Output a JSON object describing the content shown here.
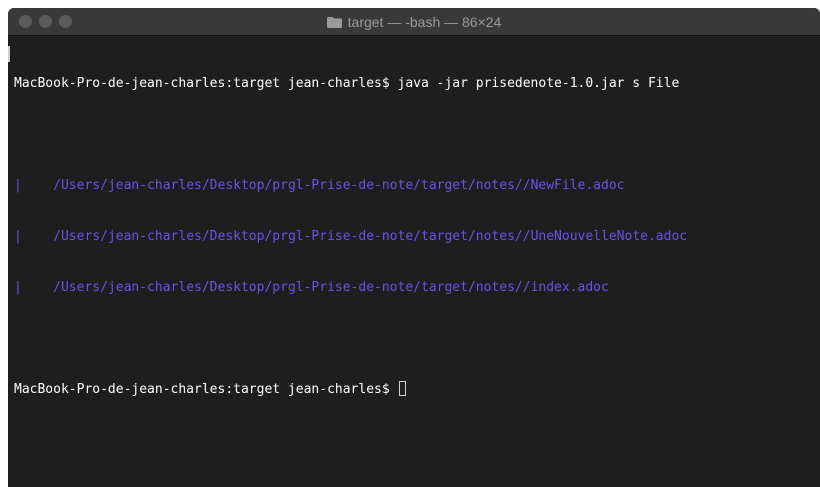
{
  "window": {
    "title": "target — -bash — 86×24"
  },
  "terminal": {
    "command_line": "MacBook-Pro-de-jean-charles:target jean-charles$ java -jar prisedenote-1.0.jar s File",
    "results": [
      {
        "bar": "|",
        "path": "/Users/jean-charles/Desktop/prgl-Prise-de-note/target/notes//NewFile.adoc"
      },
      {
        "bar": "|",
        "path": "/Users/jean-charles/Desktop/prgl-Prise-de-note/target/notes//UneNouvelleNote.adoc"
      },
      {
        "bar": "|",
        "path": "/Users/jean-charles/Desktop/prgl-Prise-de-note/target/notes//index.adoc"
      }
    ],
    "prompt": "MacBook-Pro-de-jean-charles:target jean-charles$ "
  },
  "colors": {
    "background": "#1e1e1e",
    "titlebar": "#393939",
    "text": "#ffffff",
    "path_text": "#6b52e6"
  },
  "icons": {
    "title_icon": "folder-icon",
    "window_controls": [
      "close-button",
      "minimize-button",
      "zoom-button"
    ]
  }
}
